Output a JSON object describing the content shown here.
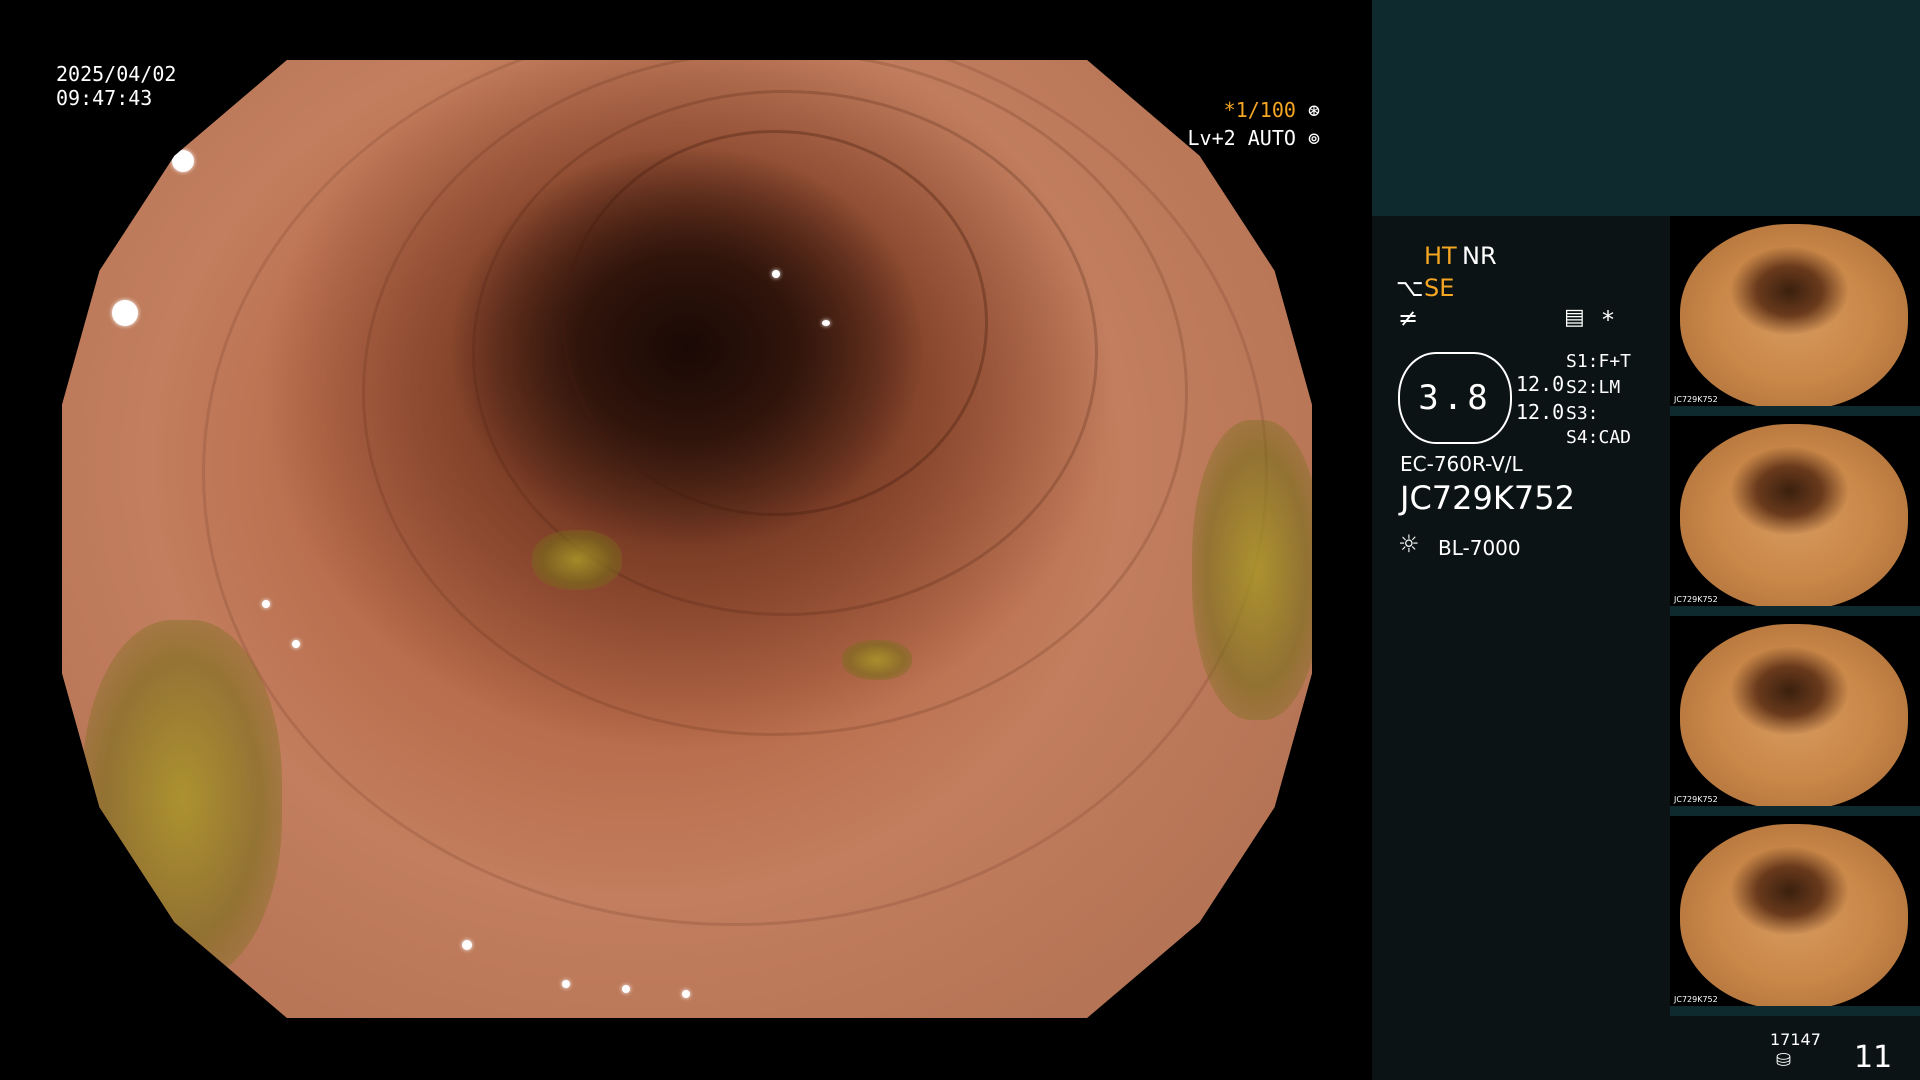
{
  "overlay": {
    "date": "2025/04/02",
    "time": "09:47:43",
    "shutter": "*1/100",
    "level": "Lv+2",
    "mode": "AUTO"
  },
  "panel": {
    "ht_label": "HT",
    "nr_label": "NR",
    "se_label": "SE",
    "zoom_value": "3.8",
    "num_a": "12.0",
    "num_b": "12.0",
    "s1": "S1:F+T",
    "s2": "S2:LM",
    "s3": "S3:",
    "s4": "S4:CAD",
    "asterisk": "*",
    "scope_model": "EC-760R-V/L",
    "scope_serial": "JC729K752",
    "light_source": "BL-7000",
    "thumb_label": "JC729K752",
    "footer_count": "17147",
    "footer_num": "11"
  },
  "colors": {
    "accent": "#f5a623",
    "panel_top": "#0e2a2e",
    "panel_bg": "#0c1314"
  }
}
